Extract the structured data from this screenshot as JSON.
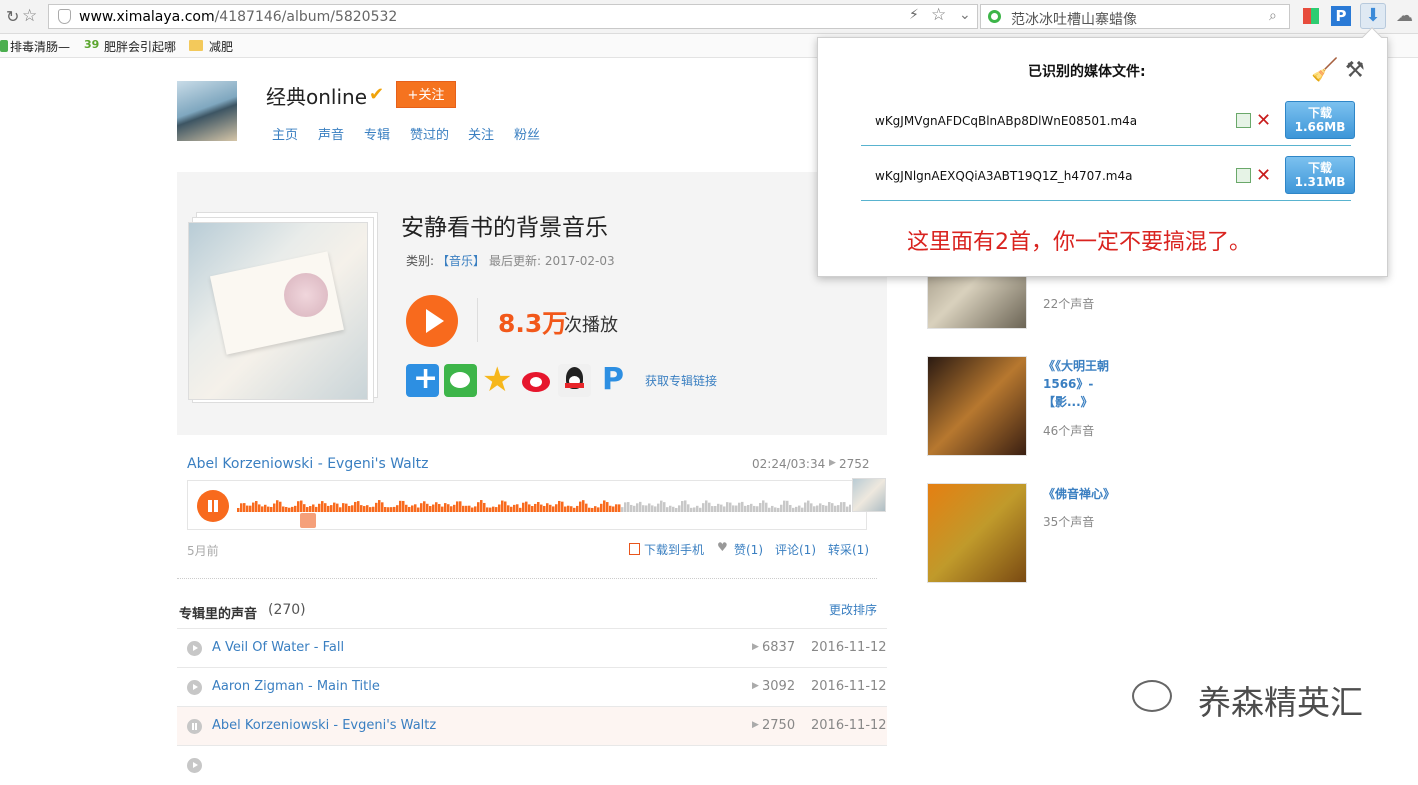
{
  "browser": {
    "url_host": "www.ximalaya.com",
    "url_path": "/4187146/album/5820532",
    "search_text": "范冰冰吐槽山寨蜡像",
    "bookmarks": [
      "排毒清肠—",
      "肥胖会引起哪",
      "减肥"
    ]
  },
  "profile": {
    "name": "经典online",
    "verified_icon": "v-badge",
    "follow_label": "+关注",
    "nav": [
      "主页",
      "声音",
      "专辑",
      "赞过的",
      "关注",
      "粉丝"
    ]
  },
  "album": {
    "title": "安静看书的背景音乐",
    "category_label": "类别:",
    "category": "【音乐】",
    "updated": "最后更新: 2017-02-03",
    "plays": "8.3万",
    "plays_suffix": "次播放",
    "get_link": "获取专辑链接",
    "share_icons": [
      "plus-share-icon",
      "wechat-icon",
      "qzone-icon",
      "weibo-icon",
      "qq-icon",
      "p-share-icon"
    ]
  },
  "player": {
    "track": "Abel Korzeniowski - Evgeni's Waltz",
    "time": "02:24/03:34",
    "plays": "2752",
    "progress": 0.625,
    "posted": "5月前",
    "download_phone": "下载到手机",
    "like": "赞(1)",
    "comment": "评论(1)",
    "collect": "转采(1)"
  },
  "tracklist": {
    "heading": "专辑里的声音",
    "count": "(270)",
    "sort": "更改排序",
    "rows": [
      {
        "title": "A Veil Of Water - Fall",
        "plays": "6837",
        "date": "2016-11-12"
      },
      {
        "title": "Aaron Zigman - Main Title",
        "plays": "3092",
        "date": "2016-11-12"
      },
      {
        "title": "Abel Korzeniowski - Evgeni's Waltz",
        "plays": "2750",
        "date": "2016-11-12"
      }
    ]
  },
  "sidebar": {
    "items": [
      {
        "title": "",
        "count": "22个声音"
      },
      {
        "title": "《《大明王朝1566》-【影...》",
        "count": "46个声音"
      },
      {
        "title": "《佛音禅心》",
        "count": "35个声音"
      }
    ]
  },
  "popup": {
    "heading": "已识别的媒体文件:",
    "files": [
      {
        "name": "wKgJMVgnAFDCqBlnABp8DlWnE08501.m4a",
        "btn_label": "下载",
        "size": "1.66MB"
      },
      {
        "name": "wKgJNlgnAEXQQiA3ABT19Q1Z_h4707.m4a",
        "btn_label": "下载",
        "size": "1.31MB"
      }
    ],
    "note": "这里面有2首，你一定不要搞混了。"
  },
  "watermark": "养森精英汇",
  "colors": {
    "accent": "#f86a1d",
    "link": "#3a7fc1",
    "note_red": "#d9231f"
  }
}
